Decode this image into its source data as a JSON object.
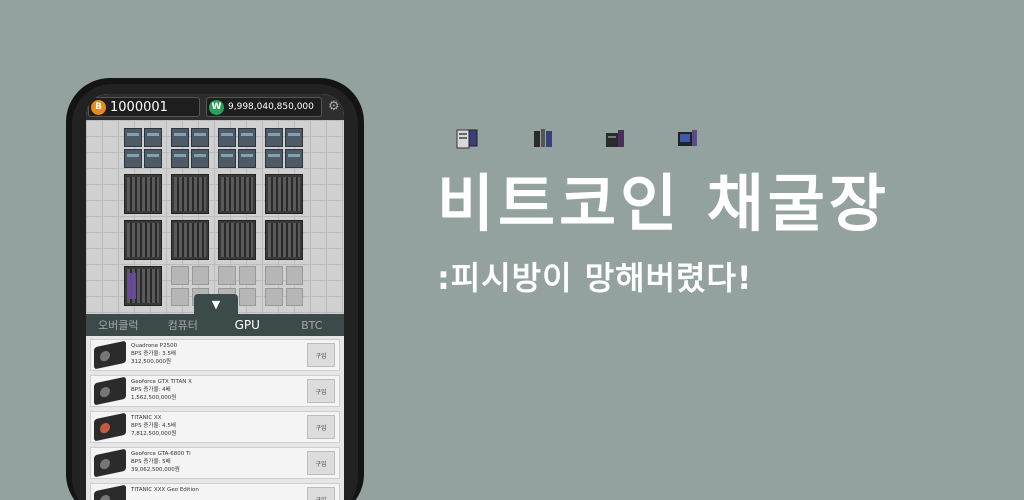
{
  "hud": {
    "btc_amount": "1000001",
    "btc_icon": "bitcoin-icon",
    "krw_amount": "9,998,040,850,000",
    "krw_icon": "won-icon",
    "krw_symbol": "W",
    "btc_symbol": "B"
  },
  "tabs": [
    {
      "label": "오버클럭"
    },
    {
      "label": "컴퓨터"
    },
    {
      "label": "GPU"
    },
    {
      "label": "BTC"
    }
  ],
  "drawer_toggle": "▼",
  "shop_items": [
    {
      "name": "Quadrone P2500",
      "bps": "BPS 증가율: 3.5배",
      "price": "312,500,000원",
      "buy": "구입"
    },
    {
      "name": "Geoforce GTX TITAN X",
      "bps": "BPS 증가율: 4배",
      "price": "1,562,500,000원",
      "buy": "구입"
    },
    {
      "name": "TITANIC XX",
      "bps": "BPS 증가율: 4.5배",
      "price": "7,812,500,000원",
      "buy": "구입"
    },
    {
      "name": "Geoforce GTA-6800 Ti",
      "bps": "BPS 증가율: 5배",
      "price": "39,062,500,000원",
      "buy": "구입"
    },
    {
      "name": "TITANIC XXX Geo Edition",
      "bps": "",
      "price": "",
      "buy": "구입"
    }
  ],
  "headline": {
    "title": "비트코인 채굴장",
    "subtitle": ":피시방이 망해버렸다!"
  },
  "colors": {
    "background": "#93a19f",
    "tab_bar": "#3d4a4a",
    "btc": "#e58a1f",
    "krw": "#2aa15a"
  }
}
